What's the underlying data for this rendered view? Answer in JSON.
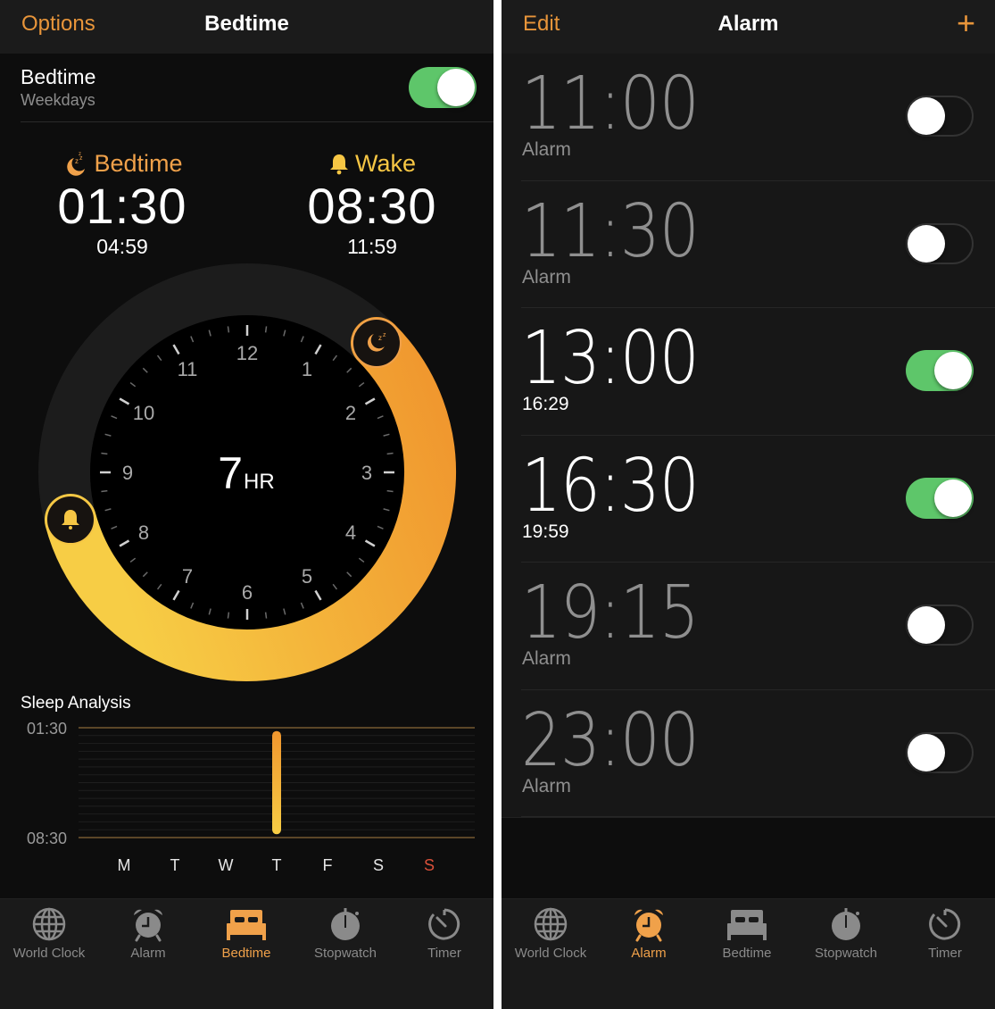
{
  "colors": {
    "accent": "#f0a14a",
    "wake_yellow": "#f6c644",
    "toggle_on": "#5ec66a",
    "weekend_red": "#d9503a"
  },
  "bedtime_screen": {
    "nav": {
      "left_button": "Options",
      "title": "Bedtime"
    },
    "schedule": {
      "title": "Bedtime",
      "subtitle": "Weekdays",
      "enabled": true
    },
    "bedtime": {
      "icon": "moon-zzz-icon",
      "label": "Bedtime",
      "time": "01:30",
      "secondary_time": "04:59"
    },
    "wake": {
      "icon": "bell-icon",
      "label": "Wake",
      "time": "08:30",
      "secondary_time": "11:59"
    },
    "dial": {
      "hour_labels": [
        "12",
        "1",
        "2",
        "3",
        "4",
        "5",
        "6",
        "7",
        "8",
        "9",
        "10",
        "11"
      ],
      "duration_value": "7",
      "duration_unit": "HR",
      "start_hour": 1.5,
      "end_hour": 8.5
    },
    "sleep_analysis": {
      "title": "Sleep Analysis",
      "top_label": "01:30",
      "bottom_label": "08:30",
      "days": [
        "M",
        "T",
        "W",
        "T",
        "F",
        "S",
        "S"
      ],
      "highlight_day_index": 6,
      "bars": [
        {
          "day_index": 3,
          "start_fraction": 0.03,
          "end_fraction": 0.97
        }
      ]
    }
  },
  "alarm_screen": {
    "nav": {
      "left_button": "Edit",
      "title": "Alarm",
      "right_button": "+"
    },
    "alarms": [
      {
        "time": "11:00",
        "sub": "Alarm",
        "enabled": false
      },
      {
        "time": "11:30",
        "sub": "Alarm",
        "enabled": false
      },
      {
        "time": "13:00",
        "sub": "16:29",
        "enabled": true
      },
      {
        "time": "16:30",
        "sub": "19:59",
        "enabled": true
      },
      {
        "time": "19:15",
        "sub": "Alarm",
        "enabled": false
      },
      {
        "time": "23:00",
        "sub": "Alarm",
        "enabled": false
      }
    ]
  },
  "tabs": [
    {
      "id": "world-clock",
      "label": "World Clock",
      "icon": "globe-icon"
    },
    {
      "id": "alarm",
      "label": "Alarm",
      "icon": "alarm-clock-icon"
    },
    {
      "id": "bedtime",
      "label": "Bedtime",
      "icon": "bed-icon"
    },
    {
      "id": "stopwatch",
      "label": "Stopwatch",
      "icon": "stopwatch-icon"
    },
    {
      "id": "timer",
      "label": "Timer",
      "icon": "timer-icon"
    }
  ],
  "left_active_tab": "bedtime",
  "right_active_tab": "alarm"
}
